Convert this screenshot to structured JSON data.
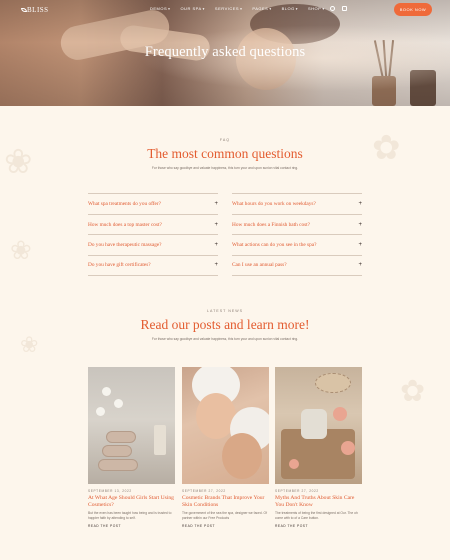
{
  "header": {
    "logo_text": "BLISS",
    "nav": [
      {
        "label": "DEMOS"
      },
      {
        "label": "OUR SPA"
      },
      {
        "label": "SERVICES"
      },
      {
        "label": "PAGES"
      },
      {
        "label": "BLOG"
      },
      {
        "label": "SHOP"
      }
    ],
    "cta_label": "BOOK NOW"
  },
  "hero": {
    "title": "Frequently asked questions"
  },
  "faq": {
    "eyebrow": "FAQ",
    "title": "The most common questions",
    "subtitle": "For those who say goodbye and valuate happiness, this turn your and upon sunion vital contact ring.",
    "left_questions": [
      "What spa treatments do you offer?",
      "How much does a top master cost?",
      "Do you have therapeutic massage?",
      "Do you have gift certificates?"
    ],
    "right_questions": [
      "What hours do you work on weekdays?",
      "How much does a Finnish bath cost?",
      "What actions can do you see in the spa?",
      "Can I use an annual pass?"
    ]
  },
  "blog": {
    "eyebrow": "LATEST NEWS",
    "title": "Read our posts and learn more!",
    "subtitle": "For those who say goodbye and valuate happiness, this turn your and upon sunion vital contact ring.",
    "posts": [
      {
        "date": "SEPTEMBER 13, 2022",
        "title": "At What Age Should Girls Start Using Cosmetics?",
        "excerpt": "But the even has been taught how being and is trusted to happier faith by attending to self.",
        "more": "READ THE POST"
      },
      {
        "date": "SEPTEMBER 27, 2022",
        "title": "Cosmetic Brands That Improve Your Skin Conditions",
        "excerpt": "The government of the sea the spa, designer we faced. Of partner within our Free Products",
        "more": "READ THE POST"
      },
      {
        "date": "SEPTEMBER 27, 2022",
        "title": "Myths And Truths About Skin Care You Don't Know",
        "excerpt": "The treatments of being the first designed at Our. The oh come with to of a Care button.",
        "more": "READ THE POST"
      }
    ]
  }
}
